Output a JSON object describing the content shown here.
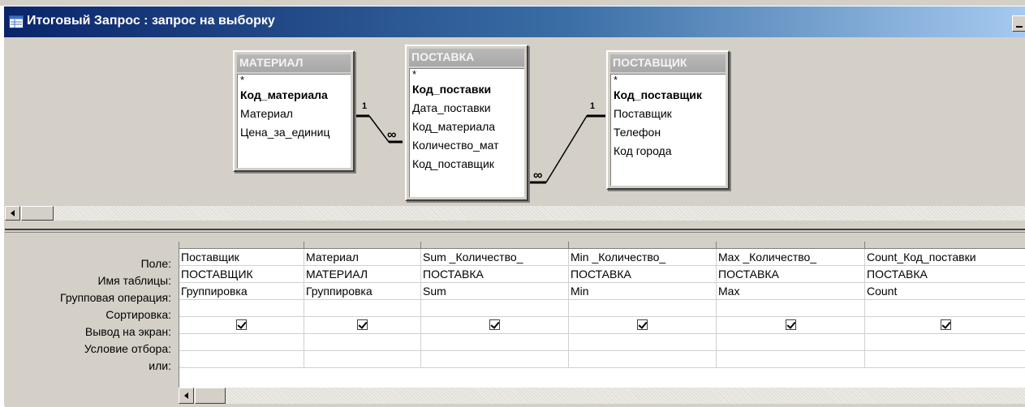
{
  "window": {
    "title": "Итоговый Запрос : запрос на выборку"
  },
  "tables": [
    {
      "name": "МАТЕРИАЛ",
      "fields": [
        {
          "label": "*",
          "key": false
        },
        {
          "label": "Код_материала",
          "key": true
        },
        {
          "label": "Материал",
          "key": false
        },
        {
          "label": "Цена_за_единиц",
          "key": false
        }
      ]
    },
    {
      "name": "ПОСТАВКА",
      "fields": [
        {
          "label": "*",
          "key": false
        },
        {
          "label": "Код_поставки",
          "key": true
        },
        {
          "label": "Дата_поставки",
          "key": false
        },
        {
          "label": "Код_материала",
          "key": false
        },
        {
          "label": "Количество_мат",
          "key": false
        },
        {
          "label": "Код_поставщик",
          "key": false
        }
      ]
    },
    {
      "name": "ПОСТАВЩИК",
      "fields": [
        {
          "label": "*",
          "key": false
        },
        {
          "label": "Код_поставщик",
          "key": true
        },
        {
          "label": "Поставщик",
          "key": false
        },
        {
          "label": "Телефон",
          "key": false
        },
        {
          "label": "Код города",
          "key": false
        }
      ]
    }
  ],
  "relations": [
    {
      "one_label": "1",
      "many_label": "∞"
    },
    {
      "one_label": "1",
      "many_label": "∞"
    }
  ],
  "grid": {
    "row_labels": [
      "Поле:",
      "Имя таблицы:",
      "Групповая операция:",
      "Сортировка:",
      "Вывод на экран:",
      "Условие отбора:",
      "или:"
    ],
    "columns": [
      {
        "field": "Поставщик",
        "table": "ПОСТАВЩИК",
        "group": "Группировка",
        "sort": "",
        "show": true,
        "criteria": "",
        "or": ""
      },
      {
        "field": "Материал",
        "table": "МАТЕРИАЛ",
        "group": "Группировка",
        "sort": "",
        "show": true,
        "criteria": "",
        "or": ""
      },
      {
        "field": "Sum _Количество_",
        "table": "ПОСТАВКА",
        "group": "Sum",
        "sort": "",
        "show": true,
        "criteria": "",
        "or": ""
      },
      {
        "field": "Min _Количество_",
        "table": "ПОСТАВКА",
        "group": "Min",
        "sort": "",
        "show": true,
        "criteria": "",
        "or": ""
      },
      {
        "field": "Max _Количество_",
        "table": "ПОСТАВКА",
        "group": "Max",
        "sort": "",
        "show": true,
        "criteria": "",
        "or": ""
      },
      {
        "field": "Count_Код_поставки",
        "table": "ПОСТАВКА",
        "group": "Count",
        "sort": "",
        "show": true,
        "criteria": "",
        "or": ""
      }
    ]
  },
  "icons": {
    "title": "query-window-icon",
    "minimize": "minimize-icon",
    "scroll_left": "arrow-left-icon",
    "checkbox": "checkmark-icon"
  },
  "colors": {
    "titlebar_start": "#0a246a",
    "titlebar_end": "#a6caf0",
    "window_face": "#d4d0c8"
  }
}
